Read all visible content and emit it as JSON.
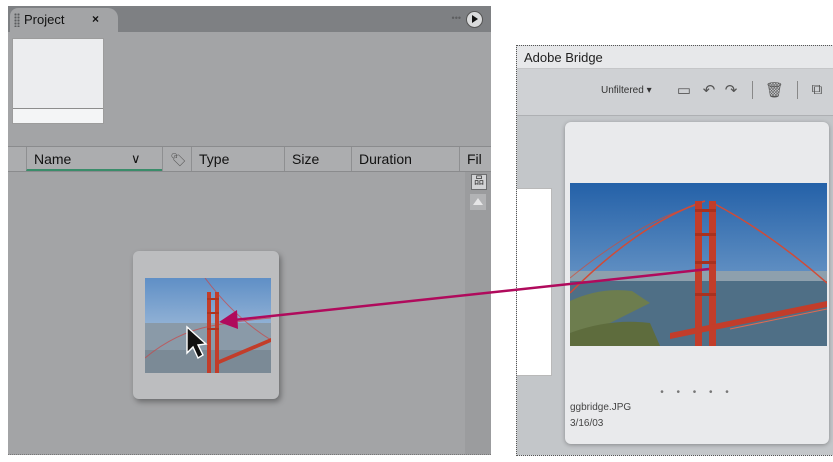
{
  "project_panel": {
    "tab_label": "Project",
    "close_glyph": "×",
    "columns": [
      {
        "label": "Name"
      },
      {
        "label": ""
      },
      {
        "label": "Type"
      },
      {
        "label": "Size"
      },
      {
        "label": "Duration"
      },
      {
        "label": "Fil"
      }
    ],
    "name_sort_glyph": "∨",
    "label_icon_glyph": "🏷"
  },
  "bridge_panel": {
    "title": "Adobe Bridge",
    "filter_label": "Unfiltered ▾",
    "toolbar_icons": [
      "new-folder-icon",
      "rotate-left-icon",
      "rotate-right-icon",
      "delete-icon",
      "compact-mode-icon"
    ],
    "thumbnail": {
      "filename": "ggbridge.JPG",
      "date": "3/16/03",
      "rating_dots": "• • • • •"
    }
  },
  "colors": {
    "project_bg": "#a3a4a6",
    "tab_bar": "#7e8083",
    "arrow": "#b00a5c",
    "bridge_tower": "#c23d2a",
    "sky": "#2f72b6"
  }
}
